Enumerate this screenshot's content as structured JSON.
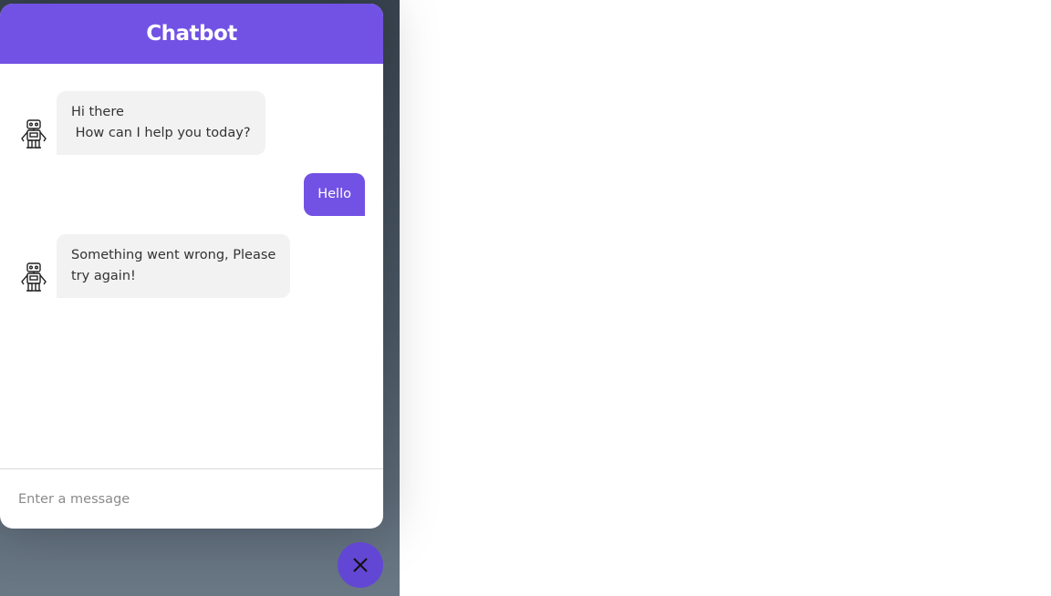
{
  "header": {
    "title": "Chatbot"
  },
  "messages": [
    {
      "role": "bot",
      "text": "Hi there\n How can I help you today?"
    },
    {
      "role": "user",
      "text": "Hello"
    },
    {
      "role": "bot",
      "text": "Something went wrong, Please\ntry again!"
    }
  ],
  "composer": {
    "placeholder": "Enter a message",
    "value": ""
  },
  "toggle": {
    "icon": "close-icon"
  },
  "colors": {
    "accent": "#7252e4",
    "toggle": "#6247d4",
    "bubble_in": "#f2f2f2",
    "backdrop": "#3e4955"
  }
}
